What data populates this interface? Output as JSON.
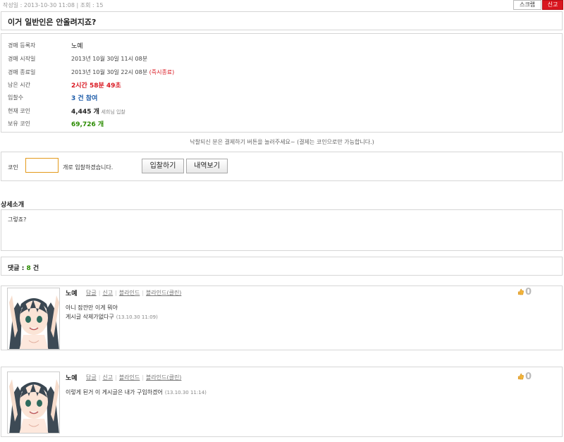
{
  "meta": {
    "line": "작성일 : 2013-10-30 11:08 | 조회 : 15",
    "scrap_label": "스크랩",
    "report_label": "신고"
  },
  "title": "이거 일반인은 안올려지죠?",
  "info": {
    "rows": [
      {
        "label": "경매 등록자",
        "value": "노예"
      },
      {
        "label": "경매 시작일",
        "value": "2013년 10월 30일 11시 08분"
      },
      {
        "label": "경매 종료일",
        "value": "2013년 10월 30일 22시 08분",
        "extra": "(즉시종료)"
      },
      {
        "label": "남은 시간",
        "value": "2시간 58분 49초"
      },
      {
        "label": "입찰수",
        "value": "3 건 참여"
      },
      {
        "label": "현재 코인",
        "value": "4,445 개",
        "extra": "세희님 입찰"
      },
      {
        "label": "보유 코인",
        "value": "69,726 개"
      }
    ]
  },
  "notice": "낙찰되신 분은 결제하기 버튼을 눌러주세요~ (결제는 코인으로만 가능합니다.)",
  "bid": {
    "label": "코인",
    "input_value": "",
    "after_text": "개로 입찰하겠습니다.",
    "bid_button": "입찰하기",
    "history_button": "내역보기"
  },
  "detail": {
    "heading": "상세소개",
    "text": "그렇죠?"
  },
  "comments_header": {
    "label": "댓글 : ",
    "count": "8",
    "unit": " 건"
  },
  "comments": [
    {
      "author": "노예",
      "links": [
        "답글",
        "신고",
        "블라인드",
        "블라인드(클린)"
      ],
      "lines": [
        "아니 잠깐만 이게 뭐야",
        "게시글 삭제가없다구"
      ],
      "time": "(13.10.30 11:09)",
      "likes": "0"
    },
    {
      "author": "노예",
      "links": [
        "답글",
        "신고",
        "블라인드",
        "블라인드(클린)"
      ],
      "lines": [
        "이렇게 된거 이 게시글은 내가 구입하겠어"
      ],
      "time": "(13.10.30 11:14)",
      "likes": "0"
    }
  ],
  "icons": {
    "like": "thumbs-up-icon",
    "avatar": "anime-girl-avatar"
  },
  "colors": {
    "accent_red": "#d9161f",
    "accent_blue": "#1a5aa8",
    "accent_green": "#2a8b00",
    "input_border": "#e39a1c"
  }
}
